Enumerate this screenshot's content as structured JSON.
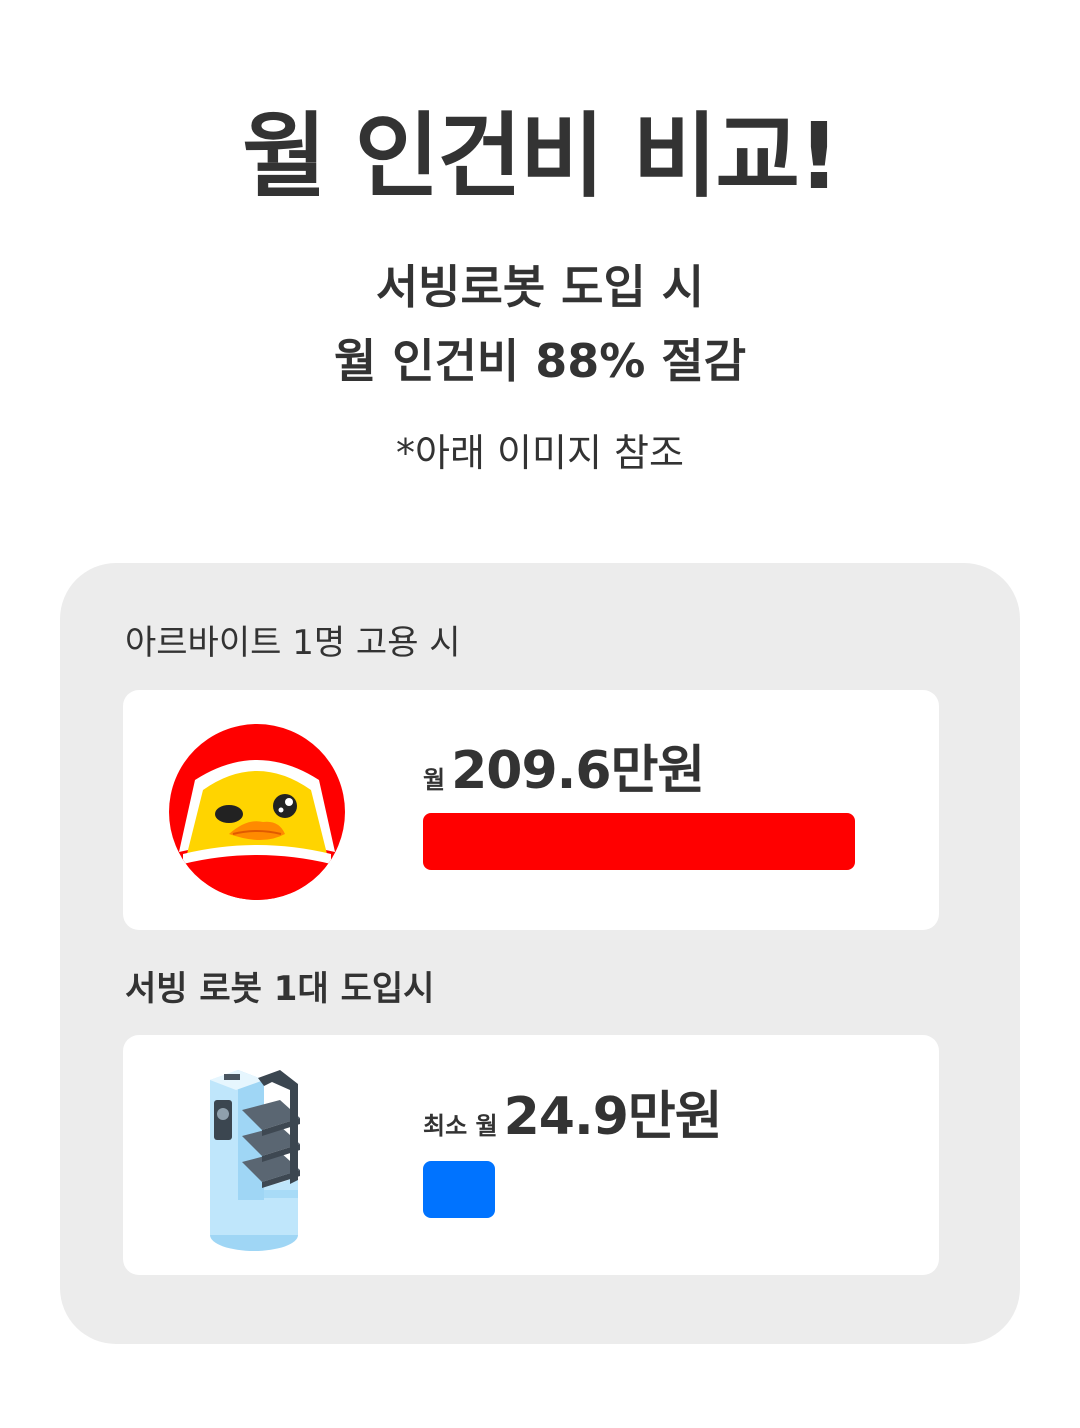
{
  "title": "월 인건비 비교!",
  "subtitle": {
    "line1": "서빙로봇 도입 시",
    "line2": "월 인건비 88% 절감"
  },
  "note": "*아래 이미지 참조",
  "comparison": {
    "parttime": {
      "label": "아르바이트 1명 고용 시",
      "prefix": "월",
      "amount": "209.6만원",
      "bar_value": 209.6,
      "bar_color": "#ff0000",
      "icon": "duck-character-icon"
    },
    "robot": {
      "label": "서빙 로봇 1대 도입시",
      "prefix": "최소 월",
      "amount": "24.9만원",
      "bar_value": 24.9,
      "bar_color": "#0073ff",
      "icon": "serving-robot-icon"
    },
    "bar_max_value": 209.6
  }
}
